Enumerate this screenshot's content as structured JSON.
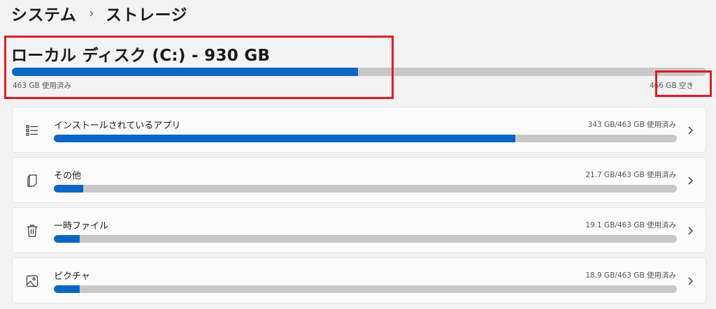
{
  "breadcrumb": {
    "parent": "システム",
    "separator": "›",
    "current": "ストレージ"
  },
  "drive": {
    "title": "ローカル ディスク (C:) - 930 GB",
    "used_text": "463 GB 使用済み",
    "free_text": "466 GB 空き",
    "used_fraction": 0.498
  },
  "categories": [
    {
      "label": "インストールされているアプリ",
      "usage": "343 GB/463 GB 使用済み",
      "fraction": 0.741,
      "icon": "apps-list-icon"
    },
    {
      "label": "その他",
      "usage": "21.7 GB/463 GB 使用済み",
      "fraction": 0.047,
      "icon": "other-files-icon"
    },
    {
      "label": "一時ファイル",
      "usage": "19.1 GB/463 GB 使用済み",
      "fraction": 0.041,
      "icon": "trash-icon"
    },
    {
      "label": "ピクチャ",
      "usage": "18.9 GB/463 GB 使用済み",
      "fraction": 0.041,
      "icon": "picture-icon"
    }
  ],
  "colors": {
    "accent": "#0a66c2",
    "track": "#c8c8c8",
    "annotation": "#e21b23"
  }
}
